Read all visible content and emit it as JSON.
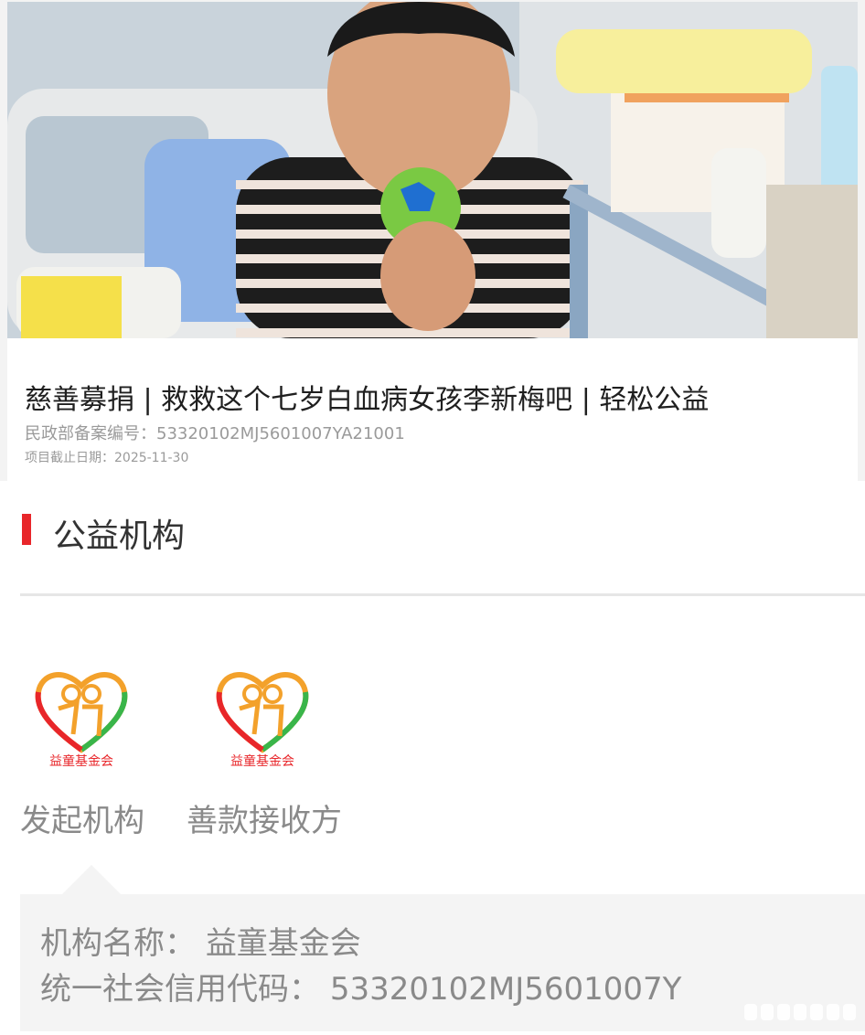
{
  "project": {
    "title": "慈善募捐 | 救救这个七岁白血病女孩李新梅吧 | 轻松公益",
    "registration": "民政部备案编号：53320102MJ5601007YA21001",
    "deadline": "项目截止日期：2025-11-30"
  },
  "section": {
    "title": "公益机构"
  },
  "org_tabs": [
    {
      "label": "发起机构",
      "logo_text": "益童基金会"
    },
    {
      "label": "善款接收方",
      "logo_text": "益童基金会"
    }
  ],
  "org_info": {
    "name_label": "机构名称：",
    "name_value": "益童基金会",
    "code_label": "统一社会信用代码：",
    "code_value": "53320102MJ5601007Y"
  },
  "colors": {
    "accent": "#e8262a",
    "text_primary": "#1f1f1f",
    "text_muted": "#8a8a8a"
  }
}
